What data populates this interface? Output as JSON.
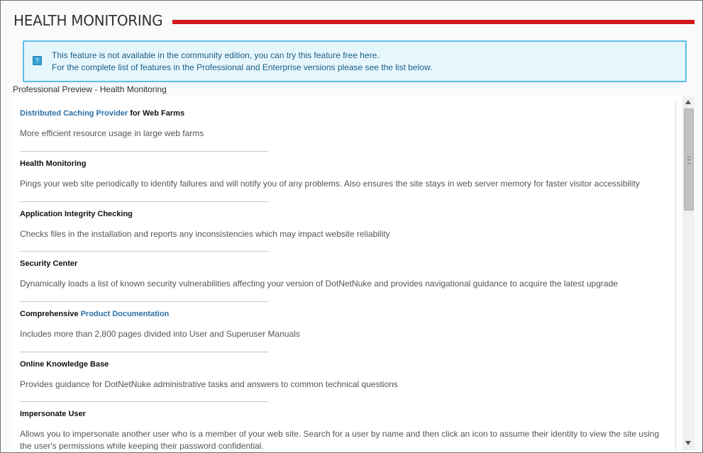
{
  "page": {
    "title": "HEALTH MONITORING"
  },
  "notice": {
    "line1_prefix": "This feature is not available in the community edition, you can try this feature free ",
    "line1_link": "here",
    "line1_suffix": ".",
    "line2": "For the complete list of features in the Professional and Enterprise versions please see the list below."
  },
  "preview_label": "Professional Preview - Health Monitoring",
  "features": [
    {
      "title_link": "Distributed Caching Provider",
      "title_rest": " for Web Farms",
      "description": "More efficient resource usage in large web farms"
    },
    {
      "title": "Health Monitoring",
      "description": "Pings your web site periodically to identify failures and will notify you of any problems. Also ensures the site stays in web server memory for faster visitor accessibility"
    },
    {
      "title": "Application Integrity Checking",
      "description": "Checks files in the installation and reports any inconsistencies which may impact website reliability"
    },
    {
      "title": "Security Center",
      "description": "Dynamically loads a list of known security vulnerabilities affecting your version of DotNetNuke and provides navigational guidance to acquire the latest upgrade"
    },
    {
      "title_prefix": "Comprehensive ",
      "title_link": "Product Documentation",
      "description": "Includes more than 2,800 pages divided into User and Superuser Manuals"
    },
    {
      "title": "Online Knowledge Base",
      "description": "Provides guidance for DotNetNuke administrative tasks and answers to common technical questions"
    },
    {
      "title": "Impersonate User",
      "description": "Allows you to impersonate another user who is a member of your web site. Search for a user by name and then click an icon to assume their identity to view the site using the user's permissions while keeping their password confidential."
    }
  ],
  "icons": {
    "notice": "info-icon",
    "scroll_up": "scroll-up-arrow-icon",
    "scroll_down": "scroll-down-arrow-icon"
  },
  "colors": {
    "title_rule": "#d0161c",
    "notice_border": "#5bbde8",
    "notice_bg": "#e6f6fd",
    "link": "#2a6ea6"
  }
}
